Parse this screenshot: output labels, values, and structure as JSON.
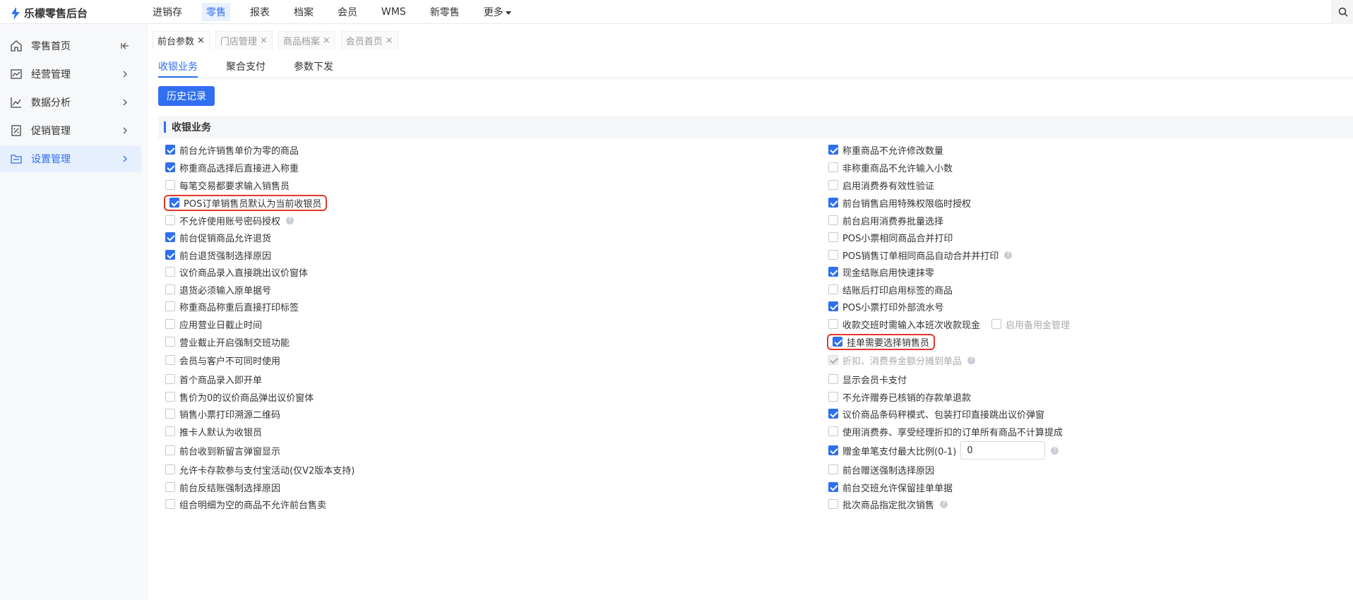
{
  "app": {
    "title": "乐檬零售后台"
  },
  "topnav": [
    {
      "label": "进销存",
      "active": false
    },
    {
      "label": "零售",
      "active": true
    },
    {
      "label": "报表",
      "active": false
    },
    {
      "label": "档案",
      "active": false
    },
    {
      "label": "会员",
      "active": false
    },
    {
      "label": "WMS",
      "active": false
    },
    {
      "label": "新零售",
      "active": false
    },
    {
      "label": "更多",
      "active": false
    }
  ],
  "sidebar": {
    "items": [
      {
        "label": "零售首页",
        "icon": "home-icon"
      },
      {
        "label": "经营管理",
        "icon": "chart-board-icon"
      },
      {
        "label": "数据分析",
        "icon": "line-chart-icon"
      },
      {
        "label": "促销管理",
        "icon": "promo-icon"
      },
      {
        "label": "设置管理",
        "icon": "folder-icon",
        "active": true
      }
    ]
  },
  "pageTabs": [
    {
      "label": "前台参数",
      "active": true
    },
    {
      "label": "门店管理"
    },
    {
      "label": "商品档案"
    },
    {
      "label": "会员首页"
    }
  ],
  "subTabs": [
    {
      "label": "收银业务",
      "active": true
    },
    {
      "label": "聚合支付"
    },
    {
      "label": "参数下发"
    }
  ],
  "historyButton": "历史记录",
  "section": {
    "title": "收银业务"
  },
  "leftOptions": [
    {
      "label": "前台允许销售单价为零的商品",
      "checked": true
    },
    {
      "label": "称重商品选择后直接进入称重",
      "checked": true
    },
    {
      "label": "每笔交易都要求输入销售员",
      "checked": false
    },
    {
      "label": "POS订单销售员默认为当前收银员",
      "checked": true,
      "highlight": true
    },
    {
      "label": "不允许使用账号密码授权",
      "checked": false,
      "help": true
    },
    {
      "label": "前台促销商品允许退货",
      "checked": true
    },
    {
      "label": "前台退货强制选择原因",
      "checked": true
    },
    {
      "label": "议价商品录入直接跳出议价窗体",
      "checked": false
    },
    {
      "label": "退货必须输入原单据号",
      "checked": false
    },
    {
      "label": "称重商品称重后直接打印标签",
      "checked": false
    },
    {
      "label": "应用营业日截止时间",
      "checked": false
    },
    {
      "label": "营业截止开启强制交班功能",
      "checked": false
    },
    {
      "label": "会员与客户不可同时使用",
      "checked": false
    },
    {
      "label": "首个商品录入即开单",
      "checked": false
    },
    {
      "label": "售价为0的议价商品弹出议价窗体",
      "checked": false
    },
    {
      "label": "销售小票打印溯源二维码",
      "checked": false
    },
    {
      "label": "推卡人默认为收银员",
      "checked": false
    },
    {
      "label": "前台收到新留言弹窗显示",
      "checked": false
    },
    {
      "label": "允许卡存款参与支付宝活动(仅V2版本支持)",
      "checked": false
    },
    {
      "label": "前台反结账强制选择原因",
      "checked": false
    },
    {
      "label": "组合明细为空的商品不允许前台售卖",
      "checked": false
    }
  ],
  "rightOptions": [
    {
      "label": "称重商品不允许修改数量",
      "checked": true
    },
    {
      "label": "非称重商品不允许输入小数",
      "checked": false
    },
    {
      "label": "启用消费券有效性验证",
      "checked": false
    },
    {
      "label": "前台销售启用特殊权限临时授权",
      "checked": true
    },
    {
      "label": "前台启用消费券批量选择",
      "checked": false
    },
    {
      "label": "POS小票相同商品合并打印",
      "checked": false
    },
    {
      "label": "POS销售订单相同商品自动合并并打印",
      "checked": false,
      "help": true
    },
    {
      "label": "现金结账启用快速抹零",
      "checked": true
    },
    {
      "label": "结账后打印启用标签的商品",
      "checked": false
    },
    {
      "label": "POS小票打印外部流水号",
      "checked": true
    },
    {
      "label": "收款交班时需输入本班次收款现金",
      "checked": false,
      "subOption": {
        "label": "启用备用金管理",
        "checked": false
      }
    },
    {
      "label": "挂单需要选择销售员",
      "checked": true,
      "highlight": true
    },
    {
      "label": "折扣、消费券金额分摊到单品",
      "checked": true,
      "disabled": true,
      "help": true
    },
    {
      "label": "显示会员卡支付",
      "checked": false
    },
    {
      "label": "不允许赠券已核销的存款单退款",
      "checked": false
    },
    {
      "label": "议价商品条码秤模式、包装打印直接跳出议价弹窗",
      "checked": true
    },
    {
      "label": "使用消费券、享受经理折扣的订单所有商品不计算提成",
      "checked": false
    },
    {
      "label": "赠金单笔支付最大比例(0-1)",
      "checked": true,
      "input": "0",
      "help": true
    },
    {
      "label": "前台赠送强制选择原因",
      "checked": false
    },
    {
      "label": "前台交班允许保留挂单单据",
      "checked": true
    },
    {
      "label": "批次商品指定批次销售",
      "checked": false,
      "help": true
    }
  ],
  "helpGlyph": "?"
}
